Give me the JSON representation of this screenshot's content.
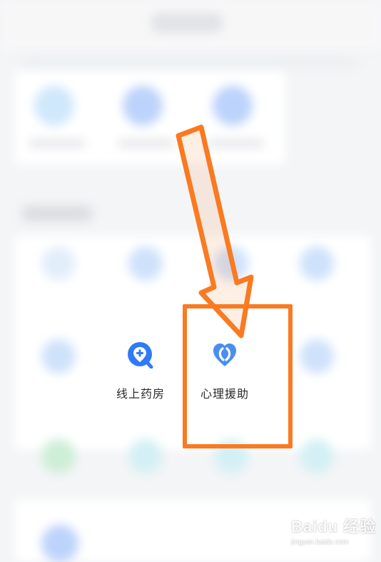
{
  "highlight_tiles": [
    {
      "label": "线上药房",
      "icon": "pharmacy-location-plus-icon",
      "color": "#2f7bf6"
    },
    {
      "label": "心理援助",
      "icon": "psychology-heart-icon",
      "color": "#4a8ff0"
    }
  ],
  "annotation": {
    "arrow_color": "#fa7a22",
    "box_color": "#fa7a22"
  },
  "watermark": {
    "main": "Baidu 经验",
    "sub": "jingyan.baidu.com"
  }
}
